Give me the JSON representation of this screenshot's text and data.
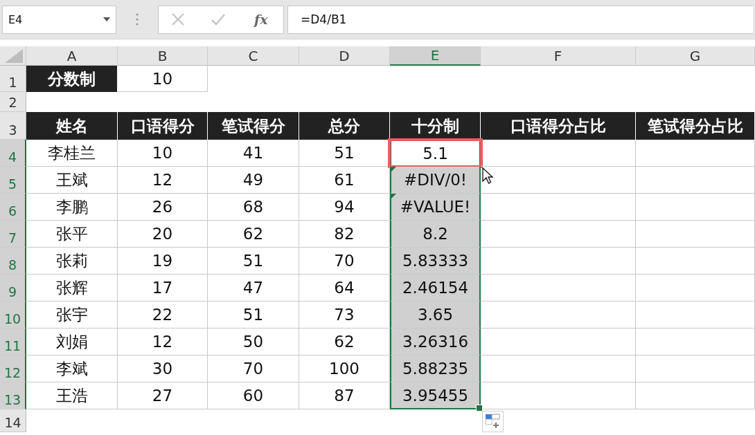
{
  "name_box": "E4",
  "function_label": "fx",
  "formula": "=D4/B1",
  "columns": [
    {
      "label": "A",
      "selected": false
    },
    {
      "label": "B",
      "selected": false
    },
    {
      "label": "C",
      "selected": false
    },
    {
      "label": "D",
      "selected": false
    },
    {
      "label": "E",
      "selected": true
    },
    {
      "label": "F",
      "selected": false
    },
    {
      "label": "G",
      "selected": false
    }
  ],
  "rows": [
    {
      "number": "1",
      "selected": false,
      "cells": [
        {
          "text": "分数制",
          "kind": "header",
          "selected": false
        },
        {
          "text": "10",
          "kind": "boxed",
          "selected": false
        }
      ]
    },
    {
      "number": "2",
      "selected": false,
      "cells": []
    },
    {
      "number": "3",
      "selected": false,
      "cells": [
        {
          "text": "姓名",
          "kind": "header",
          "selected": false
        },
        {
          "text": "口语得分",
          "kind": "header",
          "selected": false
        },
        {
          "text": "笔试得分",
          "kind": "header",
          "selected": false
        },
        {
          "text": "总分",
          "kind": "header",
          "selected": false
        },
        {
          "text": "十分制",
          "kind": "header",
          "selected": false
        },
        {
          "text": "口语得分占比",
          "kind": "header",
          "selected": false
        },
        {
          "text": "笔试得分占比",
          "kind": "header",
          "selected": false
        }
      ]
    },
    {
      "number": "4",
      "selected": true,
      "cells": [
        {
          "text": "李桂兰",
          "kind": "boxed",
          "selected": false
        },
        {
          "text": "10",
          "kind": "boxed",
          "selected": false
        },
        {
          "text": "41",
          "kind": "boxed",
          "selected": false
        },
        {
          "text": "51",
          "kind": "boxed",
          "selected": false
        },
        {
          "text": "5.1",
          "kind": "boxed",
          "selected": true,
          "active": true,
          "highlighted": true
        },
        {
          "kind": "boxed",
          "selected": false
        },
        {
          "kind": "boxed",
          "selected": false
        }
      ]
    },
    {
      "number": "5",
      "selected": true,
      "cells": [
        {
          "text": "王斌",
          "kind": "boxed",
          "selected": false
        },
        {
          "text": "12",
          "kind": "boxed",
          "selected": false
        },
        {
          "text": "49",
          "kind": "boxed",
          "selected": false
        },
        {
          "text": "61",
          "kind": "boxed",
          "selected": false
        },
        {
          "text": "#DIV/0!",
          "kind": "boxed",
          "selected": true,
          "error_flag": true
        },
        {
          "kind": "boxed",
          "selected": false
        },
        {
          "kind": "boxed",
          "selected": false
        }
      ]
    },
    {
      "number": "6",
      "selected": true,
      "cells": [
        {
          "text": "李鹏",
          "kind": "boxed",
          "selected": false
        },
        {
          "text": "26",
          "kind": "boxed",
          "selected": false
        },
        {
          "text": "68",
          "kind": "boxed",
          "selected": false
        },
        {
          "text": "94",
          "kind": "boxed",
          "selected": false
        },
        {
          "text": "#VALUE!",
          "kind": "boxed",
          "selected": true,
          "error_flag": true
        },
        {
          "kind": "boxed",
          "selected": false
        },
        {
          "kind": "boxed",
          "selected": false
        }
      ]
    },
    {
      "number": "7",
      "selected": true,
      "cells": [
        {
          "text": "张平",
          "kind": "boxed",
          "selected": false
        },
        {
          "text": "20",
          "kind": "boxed",
          "selected": false
        },
        {
          "text": "62",
          "kind": "boxed",
          "selected": false
        },
        {
          "text": "82",
          "kind": "boxed",
          "selected": false
        },
        {
          "text": "8.2",
          "kind": "boxed",
          "selected": true
        },
        {
          "kind": "boxed",
          "selected": false
        },
        {
          "kind": "boxed",
          "selected": false
        }
      ]
    },
    {
      "number": "8",
      "selected": true,
      "cells": [
        {
          "text": "张莉",
          "kind": "boxed",
          "selected": false
        },
        {
          "text": "19",
          "kind": "boxed",
          "selected": false
        },
        {
          "text": "51",
          "kind": "boxed",
          "selected": false
        },
        {
          "text": "70",
          "kind": "boxed",
          "selected": false
        },
        {
          "text": "5.83333",
          "kind": "boxed",
          "selected": true
        },
        {
          "kind": "boxed",
          "selected": false
        },
        {
          "kind": "boxed",
          "selected": false
        }
      ]
    },
    {
      "number": "9",
      "selected": true,
      "cells": [
        {
          "text": "张辉",
          "kind": "boxed",
          "selected": false
        },
        {
          "text": "17",
          "kind": "boxed",
          "selected": false
        },
        {
          "text": "47",
          "kind": "boxed",
          "selected": false
        },
        {
          "text": "64",
          "kind": "boxed",
          "selected": false
        },
        {
          "text": "2.46154",
          "kind": "boxed",
          "selected": true
        },
        {
          "kind": "boxed",
          "selected": false
        },
        {
          "kind": "boxed",
          "selected": false
        }
      ]
    },
    {
      "number": "10",
      "selected": true,
      "cells": [
        {
          "text": "张宇",
          "kind": "boxed",
          "selected": false
        },
        {
          "text": "22",
          "kind": "boxed",
          "selected": false
        },
        {
          "text": "51",
          "kind": "boxed",
          "selected": false
        },
        {
          "text": "73",
          "kind": "boxed",
          "selected": false
        },
        {
          "text": "3.65",
          "kind": "boxed",
          "selected": true
        },
        {
          "kind": "boxed",
          "selected": false
        },
        {
          "kind": "boxed",
          "selected": false
        }
      ]
    },
    {
      "number": "11",
      "selected": true,
      "cells": [
        {
          "text": "刘娟",
          "kind": "boxed",
          "selected": false
        },
        {
          "text": "12",
          "kind": "boxed",
          "selected": false
        },
        {
          "text": "50",
          "kind": "boxed",
          "selected": false
        },
        {
          "text": "62",
          "kind": "boxed",
          "selected": false
        },
        {
          "text": "3.26316",
          "kind": "boxed",
          "selected": true
        },
        {
          "kind": "boxed",
          "selected": false
        },
        {
          "kind": "boxed",
          "selected": false
        }
      ]
    },
    {
      "number": "12",
      "selected": true,
      "cells": [
        {
          "text": "李斌",
          "kind": "boxed",
          "selected": false
        },
        {
          "text": "30",
          "kind": "boxed",
          "selected": false
        },
        {
          "text": "70",
          "kind": "boxed",
          "selected": false
        },
        {
          "text": "100",
          "kind": "boxed",
          "selected": false
        },
        {
          "text": "5.88235",
          "kind": "boxed",
          "selected": true
        },
        {
          "kind": "boxed",
          "selected": false
        },
        {
          "kind": "boxed",
          "selected": false
        }
      ]
    },
    {
      "number": "13",
      "selected": true,
      "cells": [
        {
          "text": "王浩",
          "kind": "boxed",
          "selected": false
        },
        {
          "text": "27",
          "kind": "boxed",
          "selected": false
        },
        {
          "text": "60",
          "kind": "boxed",
          "selected": false
        },
        {
          "text": "87",
          "kind": "boxed",
          "selected": false
        },
        {
          "text": "3.95455",
          "kind": "boxed",
          "selected": true
        },
        {
          "kind": "boxed",
          "selected": false
        },
        {
          "kind": "boxed",
          "selected": false
        }
      ]
    },
    {
      "number": "14",
      "selected": false,
      "cells": []
    }
  ]
}
